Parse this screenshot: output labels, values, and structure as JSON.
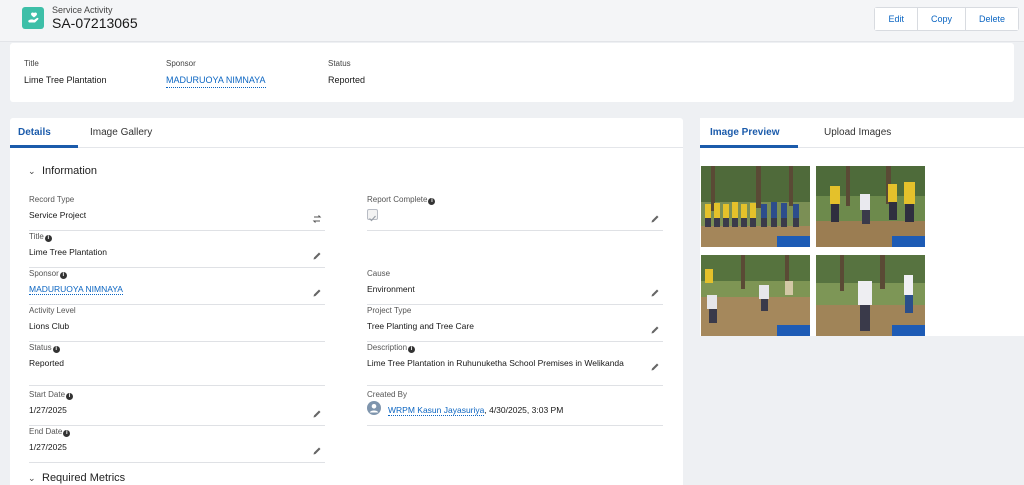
{
  "header": {
    "object_type": "Service Activity",
    "record_name": "SA-07213065",
    "buttons": {
      "edit": "Edit",
      "copy": "Copy",
      "delete": "Delete"
    }
  },
  "highlights": {
    "title_label": "Title",
    "title_value": "Lime Tree Plantation",
    "sponsor_label": "Sponsor",
    "sponsor_value": "MADURUOYA NIMNAYA",
    "status_label": "Status",
    "status_value": "Reported"
  },
  "left_tabs": [
    "Details",
    "Image Gallery"
  ],
  "section_information": "Information",
  "section_metrics": "Required Metrics",
  "fields_left": [
    {
      "label": "Record Type",
      "value": "Service Project"
    },
    {
      "label": "Title",
      "value": "Lime Tree Plantation"
    },
    {
      "label": "Sponsor",
      "value": "MADURUOYA NIMNAYA"
    },
    {
      "label": "Activity Level",
      "value": "Lions Club"
    },
    {
      "label": "Status",
      "value": "Reported"
    },
    {
      "label": "Start Date",
      "value": "1/27/2025"
    },
    {
      "label": "End Date",
      "value": "1/27/2025"
    }
  ],
  "fields_right": [
    {
      "label": "Report Complete",
      "value": ""
    },
    {
      "label": "Cause",
      "value": "Environment"
    },
    {
      "label": "Project Type",
      "value": "Tree Planting and Tree Care"
    },
    {
      "label": "Description",
      "value": "Lime Tree Plantation in Ruhunuketha School Premises in Welikanda"
    },
    {
      "label": "Created By",
      "user": "WRPM Kasun Jayasuriya",
      "date": ", 4/30/2025, 3:03 PM"
    }
  ],
  "right_tabs": [
    "Image Preview",
    "Upload Images"
  ],
  "icons": {
    "record": "heart-hand-icon",
    "edit": "pencil-icon",
    "info": "info-icon",
    "change_type": "swap-icon",
    "chevron": "chevron-down-icon"
  },
  "colors": {
    "brand": "#1b5bab",
    "link": "#0b65c2",
    "record_icon": "#3dbfa8"
  }
}
